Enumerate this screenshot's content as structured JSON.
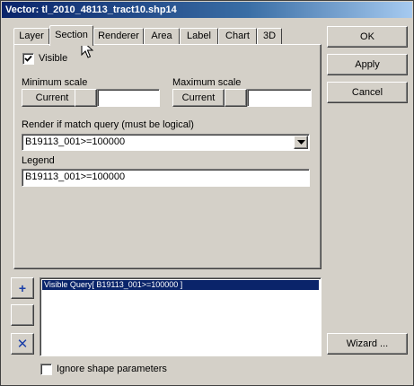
{
  "window": {
    "title": "Vector: tl_2010_48113_tract10.shp14"
  },
  "tabs": [
    {
      "label": "Layer"
    },
    {
      "label": "Section"
    },
    {
      "label": "Renderer"
    },
    {
      "label": "Area"
    },
    {
      "label": "Label"
    },
    {
      "label": "Chart"
    },
    {
      "label": "3D"
    }
  ],
  "section": {
    "visible": {
      "label": "Visible",
      "checked": true
    },
    "min_scale": {
      "label": "Minimum scale",
      "button": "Current",
      "value": ""
    },
    "max_scale": {
      "label": "Maximum scale",
      "button": "Current",
      "value": ""
    },
    "query": {
      "label": "Render if match query (must be logical)",
      "value": "B19113_001>=100000"
    },
    "legend": {
      "label": "Legend",
      "value": "B19113_001>=100000"
    }
  },
  "right_buttons": {
    "ok": "OK",
    "apply": "Apply",
    "cancel": "Cancel",
    "wizard": "Wizard ..."
  },
  "list": {
    "items": [
      "Visible Query[ B19113_001>=100000 ]"
    ]
  },
  "side_tools": {
    "add": "+",
    "remove": "✕"
  },
  "ignore_shape": {
    "label": "Ignore shape parameters",
    "checked": false
  }
}
